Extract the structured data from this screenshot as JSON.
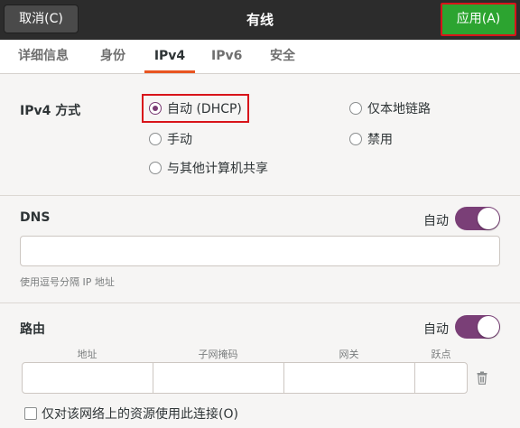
{
  "header": {
    "cancel_label": "取消(C)",
    "title": "有线",
    "apply_label": "应用(A)"
  },
  "tabs": [
    {
      "label": "详细信息"
    },
    {
      "label": "身份"
    },
    {
      "label": "IPv4"
    },
    {
      "label": "IPv6"
    },
    {
      "label": "安全"
    }
  ],
  "active_tab": "IPv4",
  "ipv4": {
    "method_label": "IPv4 方式",
    "methods": [
      {
        "label": "自动 (DHCP)",
        "checked": true
      },
      {
        "label": "仅本地链路",
        "checked": false
      },
      {
        "label": "手动",
        "checked": false
      },
      {
        "label": "禁用",
        "checked": false
      },
      {
        "label": "与其他计算机共享",
        "checked": false
      }
    ]
  },
  "dns": {
    "label": "DNS",
    "auto_label": "自动",
    "auto_on": true,
    "value": "",
    "hint": "使用逗号分隔 IP 地址"
  },
  "routes": {
    "label": "路由",
    "auto_label": "自动",
    "auto_on": true,
    "columns": [
      "地址",
      "子网掩码",
      "网关",
      "跃点"
    ],
    "only_local_label": "仅对该网络上的资源使用此连接(O)",
    "only_local_checked": false
  },
  "colors": {
    "accent_purple": "#7a3f77",
    "apply_green": "#2ca430",
    "tab_underline": "#e95420",
    "highlight_red": "#d8141a"
  }
}
